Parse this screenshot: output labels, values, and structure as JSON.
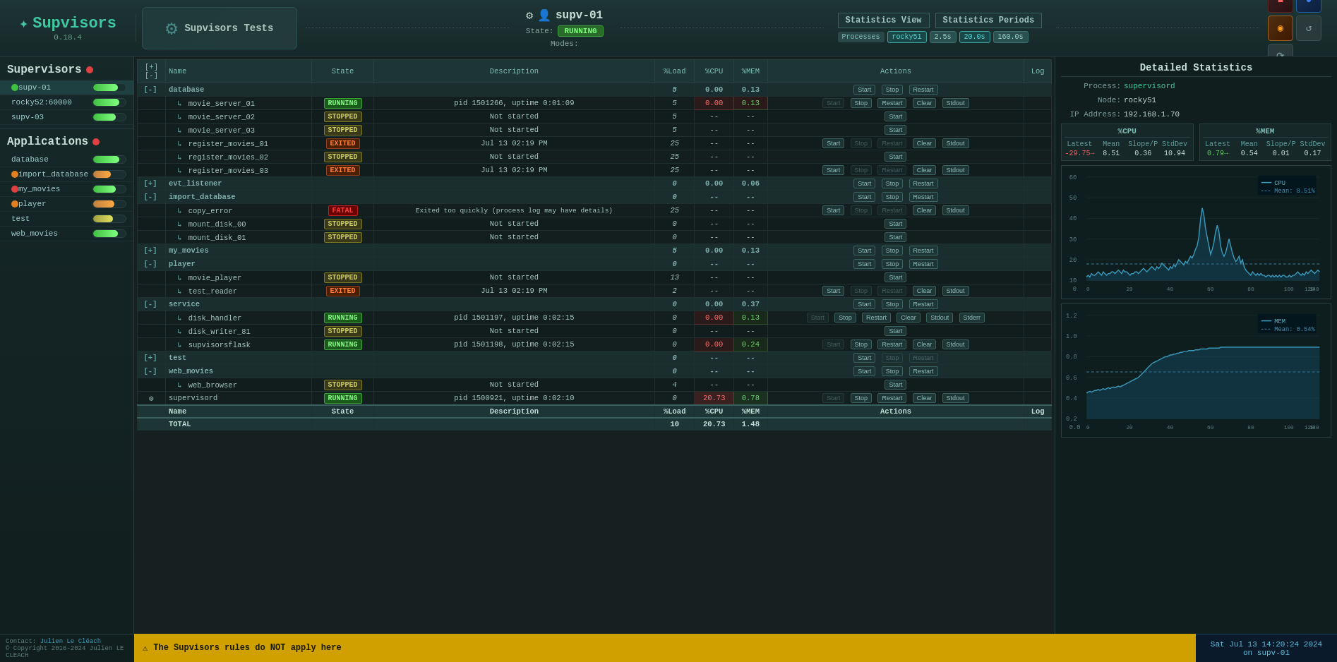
{
  "logo": {
    "title": "Supvisors",
    "version": "0.18.4",
    "icon": "✦"
  },
  "tests_panel": {
    "label": "Supvisors Tests",
    "icon": "⚙"
  },
  "node": {
    "gear_icon": "⚙",
    "user_icon": "👤",
    "name": "supv-01",
    "state_label": "State:",
    "state": "RUNNING",
    "modes_label": "Modes:"
  },
  "stats_view": {
    "title": "Statistics View",
    "periods_title": "Statistics Periods",
    "process_label": "Processes",
    "node_label": "rocky51",
    "periods": [
      "2.5s",
      "20.0s",
      "160.0s"
    ]
  },
  "toolbar_buttons": [
    {
      "id": "btn1",
      "icon": "■",
      "class": "red"
    },
    {
      "id": "btn2",
      "icon": "●",
      "class": "blue"
    },
    {
      "id": "btn3",
      "icon": "◉",
      "class": "orange"
    },
    {
      "id": "btn4",
      "icon": "↺",
      "class": "gray"
    },
    {
      "id": "btn5",
      "icon": "⟳",
      "class": "gray"
    }
  ],
  "supervisors_section": {
    "title": "Supervisors",
    "items": [
      {
        "id": "supv-01",
        "name": "supv-01",
        "active": true,
        "dot": "green",
        "bar_pct": 75,
        "bar_type": "green"
      },
      {
        "id": "rocky52",
        "name": "rocky52:60000",
        "active": false,
        "dot": "none",
        "bar_pct": 80,
        "bar_type": "green"
      },
      {
        "id": "supv-03",
        "name": "supv-03",
        "active": false,
        "dot": "none",
        "bar_pct": 70,
        "bar_type": "green"
      }
    ]
  },
  "applications_section": {
    "title": "Applications",
    "dot": "red",
    "items": [
      {
        "id": "database",
        "name": "database",
        "dot": "none",
        "bar_pct": 80,
        "bar_type": "green"
      },
      {
        "id": "import_database",
        "name": "import_database",
        "dot": "orange",
        "bar_pct": 55,
        "bar_type": "orange"
      },
      {
        "id": "my_movies",
        "name": "my_movies",
        "dot": "red",
        "bar_pct": 70,
        "bar_type": "green"
      },
      {
        "id": "player",
        "name": "player",
        "dot": "orange",
        "bar_pct": 65,
        "bar_type": "orange"
      },
      {
        "id": "test",
        "name": "test",
        "dot": "none",
        "bar_pct": 60,
        "bar_type": "yellow"
      },
      {
        "id": "web_movies",
        "name": "web_movies",
        "dot": "none",
        "bar_pct": 75,
        "bar_type": "green"
      }
    ]
  },
  "table": {
    "headers": [
      "+] [-]",
      "Name",
      "State",
      "Description",
      "%Load",
      "%CPU",
      "%MEM",
      "Actions",
      "Log"
    ],
    "footer_name": "Name",
    "footer_state": "State",
    "footer_desc": "Description",
    "footer_load": "%Load",
    "footer_cpu": "%CPU",
    "footer_mem": "%MEM",
    "footer_actions": "Actions",
    "footer_log": "Log",
    "total_label": "TOTAL",
    "total_load": "10",
    "total_cpu": "20.73",
    "total_mem": "1.48",
    "groups": [
      {
        "name": "database",
        "load": "5",
        "cpu": "0.00",
        "mem": "0.13",
        "has_start": true,
        "has_stop": true,
        "has_restart": true,
        "processes": [
          {
            "name": "↳ movie_server_01",
            "state": "RUNNING",
            "state_class": "state-running",
            "desc": "pid 1501266, uptime 0:01:09",
            "load": "5",
            "cpu": "0.00",
            "mem": "0.13",
            "cpu_highlight": true,
            "mem_highlight": true,
            "actions": [
              "Stop",
              "Restart",
              "Clear",
              "Stdout"
            ]
          },
          {
            "name": "↳ movie_server_02",
            "state": "STOPPED",
            "state_class": "state-stopped",
            "desc": "Not started",
            "load": "5",
            "cpu": "--",
            "mem": "--",
            "actions": [
              "Start"
            ]
          },
          {
            "name": "↳ movie_server_03",
            "state": "STOPPED",
            "state_class": "state-stopped",
            "desc": "Not started",
            "load": "5",
            "cpu": "--",
            "mem": "--",
            "actions": [
              "Start"
            ]
          },
          {
            "name": "↳ register_movies_01",
            "state": "EXITED",
            "state_class": "state-exited",
            "desc": "Jul 13 02:19 PM",
            "load": "25",
            "cpu": "--",
            "mem": "--",
            "actions": [
              "Start",
              "Clear",
              "Stdout"
            ]
          },
          {
            "name": "↳ register_movies_02",
            "state": "STOPPED",
            "state_class": "state-stopped",
            "desc": "Not started",
            "load": "25",
            "cpu": "--",
            "mem": "--",
            "actions": [
              "Start"
            ]
          },
          {
            "name": "↳ register_movies_03",
            "state": "EXITED",
            "state_class": "state-exited",
            "desc": "Jul 13 02:19 PM",
            "load": "25",
            "cpu": "--",
            "mem": "--",
            "actions": [
              "Start",
              "Clear",
              "Stdout"
            ]
          }
        ]
      },
      {
        "name": "evt_listener",
        "load": "0",
        "cpu": "0.00",
        "mem": "0.06",
        "has_start": true,
        "has_stop": true,
        "has_restart": true,
        "processes": []
      },
      {
        "name": "import_database",
        "load": "0",
        "cpu": "--",
        "mem": "--",
        "has_start": true,
        "has_stop": true,
        "has_restart": true,
        "processes": [
          {
            "name": "↳ copy_error",
            "state": "FATAL",
            "state_class": "state-fatal",
            "desc": "Exited too quickly (process log may have details)",
            "load": "25",
            "cpu": "--",
            "mem": "--",
            "actions": [
              "Start",
              "Clear",
              "Stdout"
            ]
          },
          {
            "name": "↳ mount_disk_00",
            "state": "STOPPED",
            "state_class": "state-stopped",
            "desc": "Not started",
            "load": "0",
            "cpu": "--",
            "mem": "--",
            "actions": [
              "Start"
            ]
          },
          {
            "name": "↳ mount_disk_01",
            "state": "STOPPED",
            "state_class": "state-stopped",
            "desc": "Not started",
            "load": "0",
            "cpu": "--",
            "mem": "--",
            "actions": [
              "Start"
            ]
          }
        ]
      },
      {
        "name": "my_movies",
        "load": "5",
        "cpu": "0.00",
        "mem": "0.13",
        "has_start": true,
        "has_stop": true,
        "has_restart": true,
        "processes": []
      },
      {
        "name": "player",
        "load": "0",
        "cpu": "--",
        "mem": "--",
        "has_start": true,
        "has_stop": true,
        "has_restart": true,
        "processes": [
          {
            "name": "↳ movie_player",
            "state": "STOPPED",
            "state_class": "state-stopped",
            "desc": "Not started",
            "load": "13",
            "cpu": "--",
            "mem": "--",
            "actions": [
              "Start"
            ]
          },
          {
            "name": "↳ test_reader",
            "state": "EXITED",
            "state_class": "state-exited",
            "desc": "Jul 13 02:19 PM",
            "load": "2",
            "cpu": "--",
            "mem": "--",
            "actions": [
              "Start",
              "Clear",
              "Stdout"
            ]
          }
        ]
      },
      {
        "name": "service",
        "load": "0",
        "cpu": "0.00",
        "mem": "0.37",
        "has_start": true,
        "has_stop": true,
        "has_restart": true,
        "processes": [
          {
            "name": "↳ disk_handler",
            "state": "RUNNING",
            "state_class": "state-running",
            "desc": "pid 1501197, uptime 0:02:15",
            "load": "0",
            "cpu": "0.00",
            "mem": "0.13",
            "actions": [
              "Stop",
              "Restart",
              "Clear",
              "Stdout",
              "Stderr"
            ]
          },
          {
            "name": "↳ disk_writer_81",
            "state": "STOPPED",
            "state_class": "state-stopped",
            "desc": "Not started",
            "load": "0",
            "cpu": "--",
            "mem": "--",
            "actions": [
              "Start"
            ]
          },
          {
            "name": "↳ supvisorsflask",
            "state": "RUNNING",
            "state_class": "state-running",
            "desc": "pid 1501198, uptime 0:02:15",
            "load": "0",
            "cpu": "0.00",
            "mem": "0.24",
            "actions": [
              "Stop",
              "Restart",
              "Clear",
              "Stdout"
            ]
          }
        ]
      },
      {
        "name": "test",
        "load": "0",
        "cpu": "--",
        "mem": "--",
        "has_start": true,
        "has_stop": false,
        "has_restart": false,
        "processes": []
      },
      {
        "name": "web_movies",
        "load": "0",
        "cpu": "--",
        "mem": "--",
        "has_start": true,
        "has_stop": true,
        "has_restart": true,
        "processes": [
          {
            "name": "↳ web_browser",
            "state": "STOPPED",
            "state_class": "state-stopped",
            "desc": "Not started",
            "load": "4",
            "cpu": "--",
            "mem": "--",
            "actions": [
              "Start"
            ]
          }
        ]
      }
    ],
    "supervisord": {
      "name": "supervisord",
      "state": "RUNNING",
      "desc": "pid 1500921, uptime 0:02:10",
      "load": "0",
      "cpu": "20.73",
      "mem": "0.78",
      "actions": [
        "Stop",
        "Restart",
        "Clear",
        "Stdout"
      ]
    }
  },
  "detail_stats": {
    "title": "Detailed Statistics",
    "process_label": "Process:",
    "process_value": "supervisord",
    "node_label": "Node:",
    "node_value": "rocky51",
    "ip_label": "IP Address:",
    "ip_value": "192.168.1.70",
    "cpu_section": {
      "title": "%CPU",
      "headers": [
        "Latest",
        "Mean",
        "Slope/P",
        "StdDev"
      ],
      "values": [
        "-29.75→",
        "8.51",
        "0.36",
        "10.94"
      ]
    },
    "mem_section": {
      "title": "%MEM",
      "headers": [
        "Latest",
        "Mean",
        "Slope/P",
        "StdDev"
      ],
      "values": [
        "0.79→",
        "0.54",
        "0.01",
        "0.17"
      ]
    },
    "cpu_chart": {
      "title": "CPU",
      "mean_label": "Mean: 8.51%",
      "y_max": 60,
      "x_max": 140,
      "data": [
        2,
        3,
        2,
        4,
        3,
        3,
        4,
        5,
        4,
        3,
        5,
        4,
        3,
        4,
        4,
        5,
        5,
        4,
        5,
        6,
        5,
        4,
        6,
        5,
        5,
        4,
        3,
        4,
        4,
        5,
        5,
        4,
        5,
        6,
        7,
        6,
        5,
        6,
        7,
        8,
        7,
        6,
        8,
        7,
        8,
        10,
        9,
        8,
        7,
        6,
        8,
        7,
        9,
        8,
        10,
        12,
        11,
        10,
        9,
        11,
        10,
        12,
        14,
        13,
        15,
        18,
        20,
        25,
        35,
        42,
        38,
        30,
        25,
        20,
        15,
        18,
        22,
        28,
        32,
        28,
        20,
        16,
        14,
        16,
        20,
        24,
        20,
        16,
        13,
        11,
        12,
        14,
        10,
        12,
        8,
        6,
        5,
        4,
        3,
        5,
        4,
        3,
        4,
        3,
        4,
        3,
        3,
        2,
        3,
        3,
        2,
        3,
        2,
        3,
        2,
        3,
        2,
        3,
        3,
        2,
        2,
        3,
        2,
        3,
        3,
        4,
        5,
        4,
        3,
        4,
        3,
        5,
        4,
        5,
        6,
        5,
        4,
        5,
        6,
        5
      ]
    },
    "mem_chart": {
      "title": "MEM",
      "mean_label": "Mean: 0.54%",
      "y_max": 1.2,
      "x_max": 140,
      "data": [
        0.3,
        0.31,
        0.32,
        0.31,
        0.32,
        0.33,
        0.33,
        0.34,
        0.33,
        0.34,
        0.35,
        0.34,
        0.35,
        0.36,
        0.35,
        0.36,
        0.37,
        0.36,
        0.37,
        0.38,
        0.37,
        0.38,
        0.39,
        0.4,
        0.41,
        0.42,
        0.43,
        0.44,
        0.45,
        0.46,
        0.47,
        0.48,
        0.5,
        0.52,
        0.54,
        0.56,
        0.58,
        0.6,
        0.62,
        0.64,
        0.65,
        0.66,
        0.67,
        0.68,
        0.69,
        0.7,
        0.71,
        0.72,
        0.72,
        0.73,
        0.74,
        0.74,
        0.75,
        0.75,
        0.76,
        0.76,
        0.77,
        0.77,
        0.78,
        0.78,
        0.78,
        0.79,
        0.79,
        0.79,
        0.79,
        0.8,
        0.8,
        0.8,
        0.81,
        0.81,
        0.81,
        0.81,
        0.81,
        0.82,
        0.82,
        0.82,
        0.82,
        0.82,
        0.82,
        0.82,
        0.83,
        0.83,
        0.83,
        0.83,
        0.83,
        0.83,
        0.83,
        0.83,
        0.83,
        0.83,
        0.83,
        0.83,
        0.83,
        0.83,
        0.83,
        0.83,
        0.83,
        0.83,
        0.83,
        0.83,
        0.83,
        0.83,
        0.83,
        0.83,
        0.83,
        0.83,
        0.83,
        0.83,
        0.83,
        0.83,
        0.83,
        0.83,
        0.83,
        0.83,
        0.83,
        0.83,
        0.83,
        0.83,
        0.83,
        0.83,
        0.83,
        0.83,
        0.83,
        0.83,
        0.83,
        0.83,
        0.83,
        0.83,
        0.83,
        0.83,
        0.83,
        0.83,
        0.83,
        0.83,
        0.83,
        0.83,
        0.83,
        0.83,
        0.83,
        0.83
      ]
    }
  },
  "footer": {
    "contact_label": "Contact:",
    "contact_name": "Julien Le Cléach",
    "copyright": "© Copyright 2016-2024 Julien LE CLEACH",
    "warning_icon": "⚠",
    "warning_text": "The Supvisors rules do NOT apply here",
    "datetime": "Sat Jul 13 14:20:24 2024",
    "node": "on supv-01"
  }
}
